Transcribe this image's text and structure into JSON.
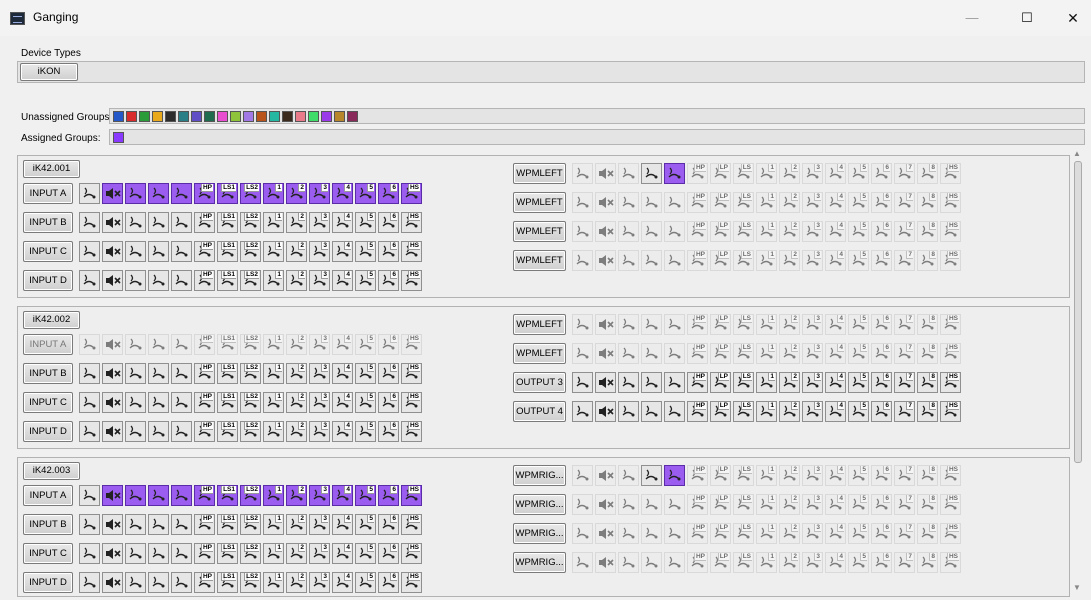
{
  "window": {
    "title": "Ganging",
    "minimize": "—",
    "maximize": "☐",
    "close": "✕"
  },
  "device_types": {
    "label": "Device Types",
    "button": "iKON"
  },
  "groups": {
    "unassigned_label": "Unassigned Groups:",
    "assigned_label": "Assigned Groups:",
    "unassigned_colors": [
      "#2457c7",
      "#d92b2b",
      "#2b9c3a",
      "#e8a91c",
      "#2c2c2c",
      "#2a7f87",
      "#5f4ec6",
      "#1e6b4e",
      "#e84fd0",
      "#8fc43a",
      "#a178e6",
      "#b8531c",
      "#24b8a2",
      "#3a2a1e",
      "#e87a8a",
      "#3fdc6a",
      "#9b3ae8",
      "#b8862a",
      "#8a2a5a"
    ],
    "assigned_colors": [
      "#8a3aff"
    ]
  },
  "icons": [
    "mic-phase-icon",
    "mute-icon",
    "gain-icon",
    "filter-icon",
    "eq-curve-icon",
    "high-pass-icon",
    "low-shelf-1-icon",
    "low-shelf-2-icon",
    "band-1-icon",
    "band-2-icon",
    "band-3-icon",
    "band-4-icon",
    "band-5-icon",
    "band-6-icon",
    "high-shelf-icon"
  ],
  "icon_sup_left": [
    "",
    "",
    "",
    "",
    "",
    "HP",
    "LS1",
    "LS2",
    "1",
    "2",
    "3",
    "4",
    "5",
    "6",
    "HS"
  ],
  "icon_sup_right": [
    "",
    "",
    "",
    "",
    "",
    "HP",
    "LP",
    "LS",
    "1",
    "2",
    "3",
    "4",
    "5",
    "6",
    "7",
    "8",
    "HS",
    ""
  ],
  "devices": [
    {
      "name": "iK42.001",
      "left": [
        {
          "label": "INPUT A",
          "pattern": "pA"
        },
        {
          "label": "INPUT B",
          "pattern": "n"
        },
        {
          "label": "INPUT C",
          "pattern": "n"
        },
        {
          "label": "INPUT D",
          "pattern": "n"
        }
      ],
      "right": [
        {
          "label": "WPMLEFT",
          "pattern": "wA"
        },
        {
          "label": "WPMLEFT",
          "pattern": "d"
        },
        {
          "label": "WPMLEFT",
          "pattern": "d"
        },
        {
          "label": "WPMLEFT",
          "pattern": "d"
        }
      ]
    },
    {
      "name": "iK42.002",
      "left": [
        {
          "label": "INPUT A",
          "pattern": "d"
        },
        {
          "label": "INPUT B",
          "pattern": "n"
        },
        {
          "label": "INPUT C",
          "pattern": "n"
        },
        {
          "label": "INPUT D",
          "pattern": "n"
        }
      ],
      "right": [
        {
          "label": "WPMLEFT",
          "pattern": "d"
        },
        {
          "label": "WPMLEFT",
          "pattern": "d"
        },
        {
          "label": "OUTPUT 3",
          "pattern": "n"
        },
        {
          "label": "OUTPUT 4",
          "pattern": "n"
        }
      ]
    },
    {
      "name": "iK42.003",
      "left": [
        {
          "label": "INPUT A",
          "pattern": "pA"
        },
        {
          "label": "INPUT B",
          "pattern": "n"
        },
        {
          "label": "INPUT C",
          "pattern": "n"
        },
        {
          "label": "INPUT D",
          "pattern": "n"
        }
      ],
      "right": [
        {
          "label": "WPMRIG...",
          "pattern": "wA"
        },
        {
          "label": "WPMRIG...",
          "pattern": "d"
        },
        {
          "label": "WPMRIG...",
          "pattern": "d"
        },
        {
          "label": "WPMRIG...",
          "pattern": "d"
        }
      ]
    }
  ],
  "colors": {
    "accent_purple": "#9b5cf0"
  }
}
